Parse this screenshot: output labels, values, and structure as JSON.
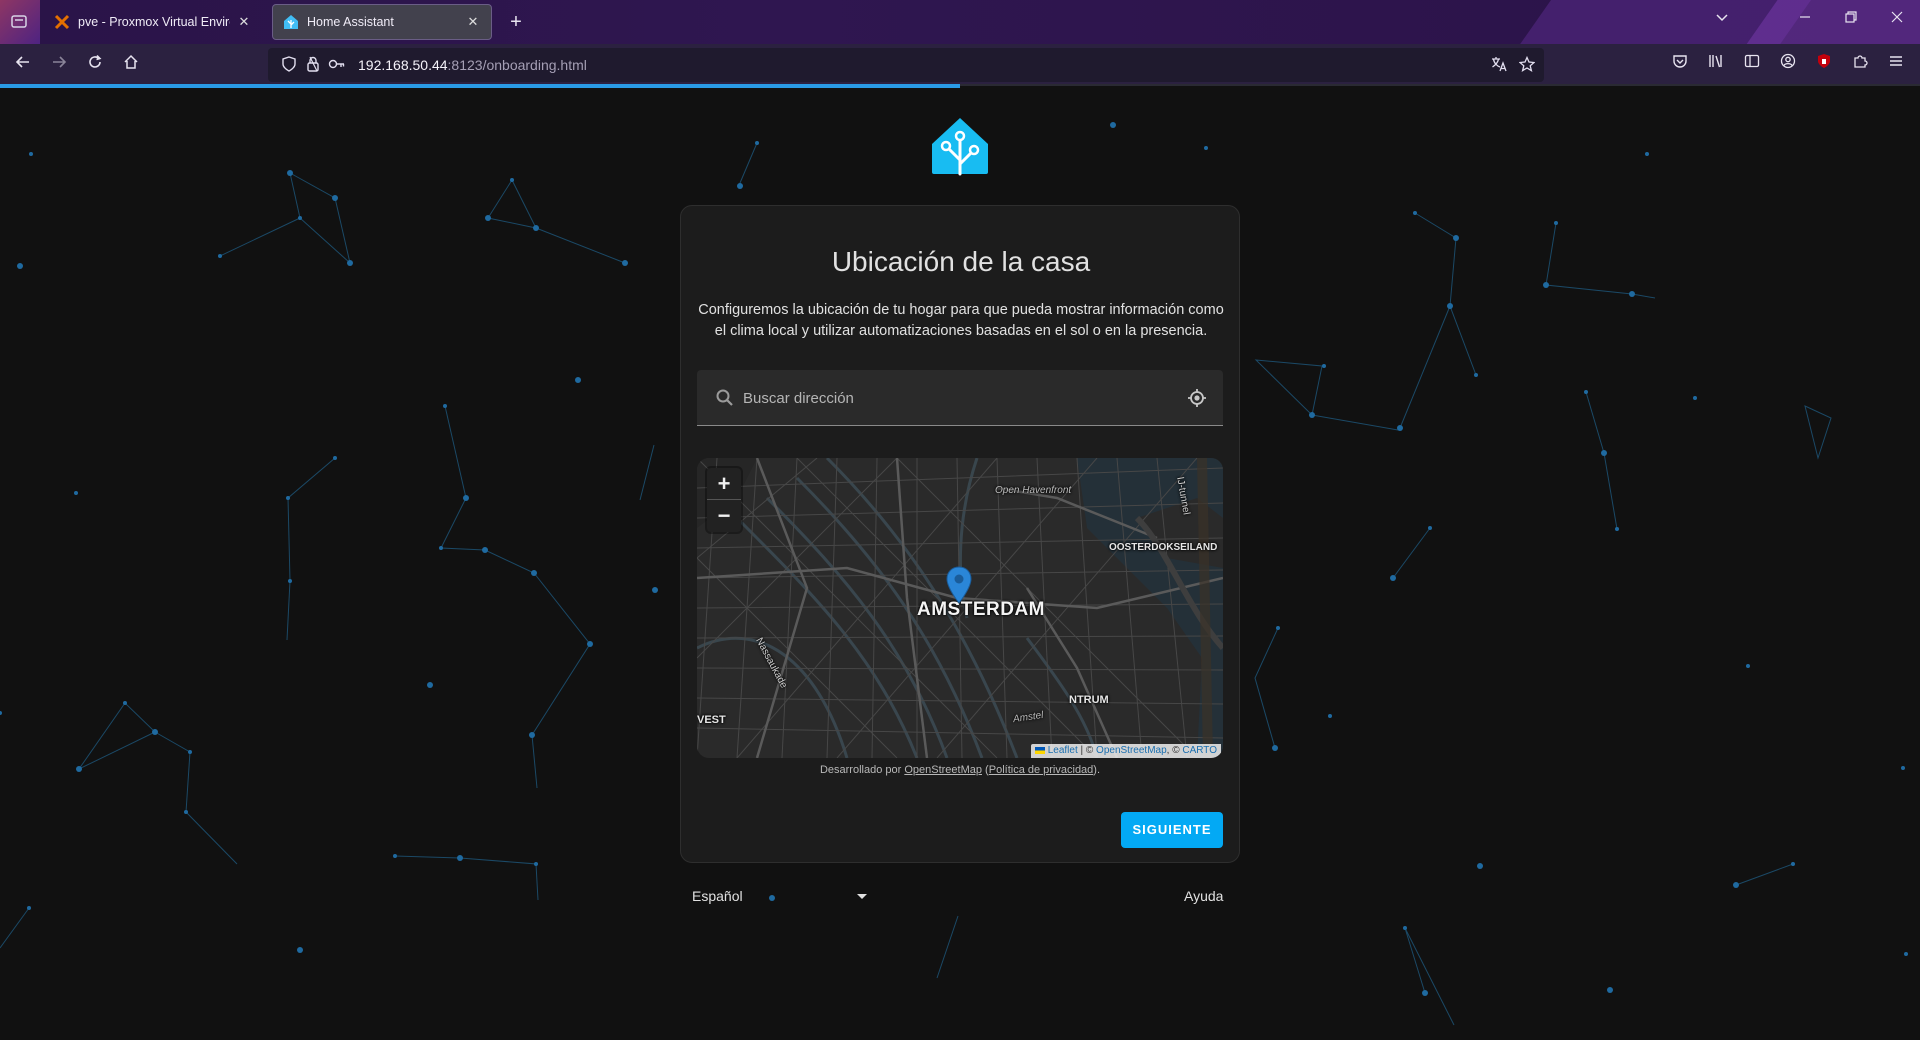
{
  "browser": {
    "tabs": [
      {
        "title": "pve - Proxmox Virtual Environm",
        "favicon": "proxmox-icon",
        "active": false
      },
      {
        "title": "Home Assistant",
        "favicon": "home-assistant-icon",
        "active": true
      }
    ],
    "url_host": "192.168.50.44",
    "url_path": ":8123/onboarding.html",
    "new_tab_label": "+",
    "close_label": "✕"
  },
  "page": {
    "title": "Ubicación de la casa",
    "intro": "Configuremos la ubicación de tu hogar para que pueda mostrar información como el clima local y utilizar automatizaciones basadas en el sol o en la presencia.",
    "search_placeholder": "Buscar dirección",
    "map": {
      "zoom_in": "+",
      "zoom_out": "−",
      "labels": {
        "city": "AMSTERDAM",
        "havenfront": "Open Havenfront",
        "oosterdok": "OOSTERDOKSEILAND",
        "tunnel": "IJ-tunnel",
        "nassau": "Nassaukade",
        "centrum": "NTRUM",
        "west": "VEST",
        "street2": "Amstel"
      },
      "attribution": {
        "leaflet": "Leaflet",
        "sep1": " | © ",
        "osm": "OpenStreetMap",
        "sep2": ", © ",
        "carto": "CARTO"
      }
    },
    "osm_credit": {
      "prefix": "Desarrollado por ",
      "osm_link": "OpenStreetMap",
      "mid": " (",
      "privacy_link": "Política de privacidad",
      "suffix": ")."
    },
    "next_button": "SIGUIENTE",
    "language": "Español",
    "help": "Ayuda"
  },
  "colors": {
    "accent": "#03a9f4",
    "progress": "#2a9be6",
    "background": "#111111",
    "card": "#1c1c1c"
  }
}
